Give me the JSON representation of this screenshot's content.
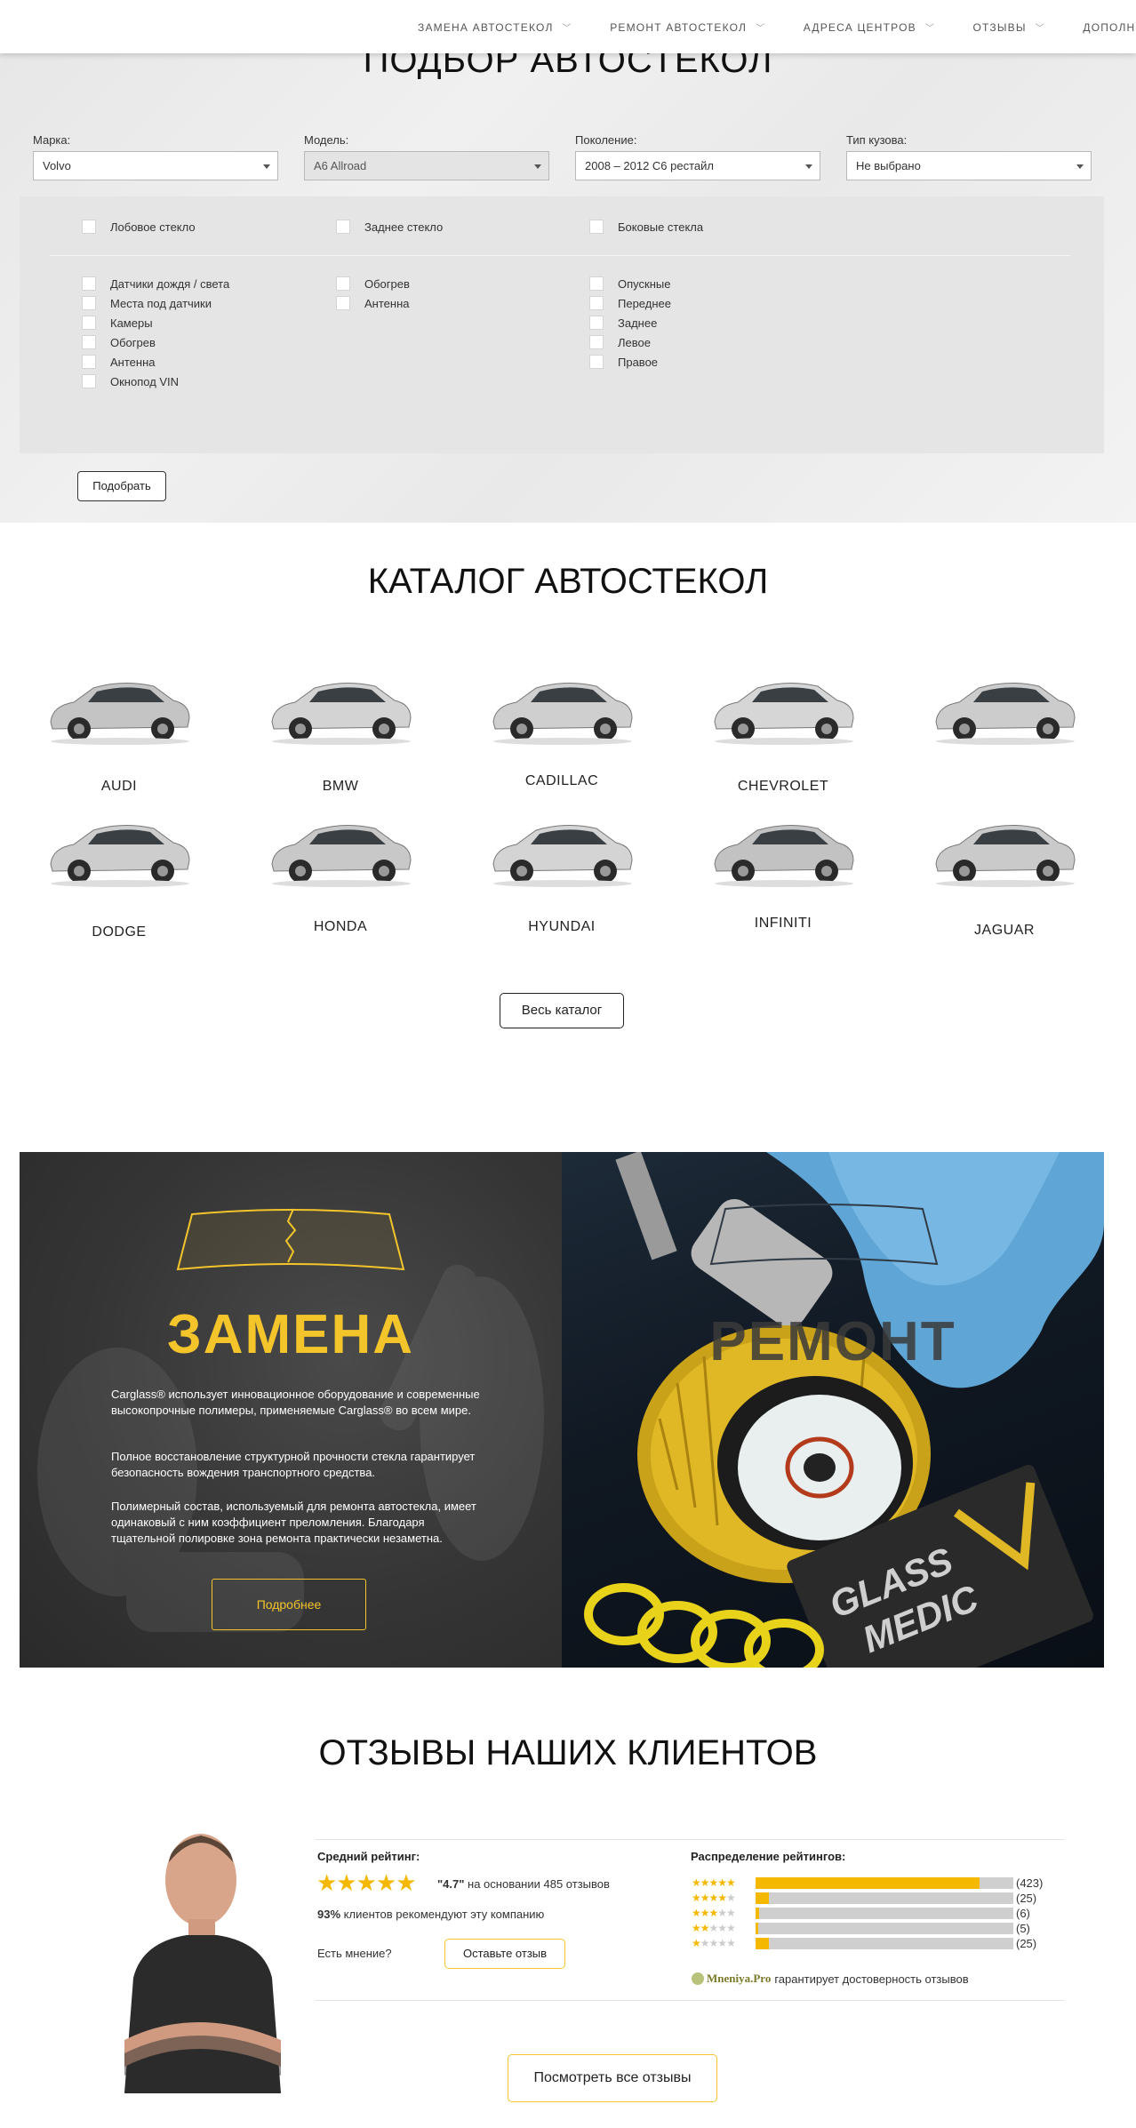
{
  "nav": {
    "items": [
      {
        "label": "ЗАМЕНА АВТОСТЕКОЛ"
      },
      {
        "label": "РЕМОНТ АВТОСТЕКОЛ"
      },
      {
        "label": "АДРЕСА ЦЕНТРОВ"
      },
      {
        "label": "ОТЗЫВЫ"
      },
      {
        "label": "ДОПОЛНИТЕЛЬНЫЕ УСЛУГИ"
      }
    ]
  },
  "selector": {
    "title": "ПОДБОР АВТОСТЕКОЛ",
    "fields": [
      {
        "label": "Марка:",
        "value": "Volvo"
      },
      {
        "label": "Модель:",
        "value": "A6 Allroad"
      },
      {
        "label": "Поколение:",
        "value": "2008 – 2012 C6 рестайл"
      },
      {
        "label": "Тип кузова:",
        "value": "Не выбрано"
      }
    ],
    "glass_types": [
      "Лобовое стекло",
      "Заднее стекло",
      "Боковые стекла"
    ],
    "options_col1": [
      "Датчики дождя / света",
      "Места под датчики",
      "Камеры",
      "Обогрев",
      "Антенна",
      "Окнопод VIN"
    ],
    "options_col2": [
      "Обогрев",
      "Антенна"
    ],
    "options_col3": [
      "Опускные",
      "Переднее",
      "Заднее",
      "Левое",
      "Правое"
    ],
    "submit_label": "Подобрать"
  },
  "catalog": {
    "title": "КАТАЛОГ АВТОСТЕКОЛ",
    "brands": [
      "AUDI",
      "BMW",
      "CADILLAC",
      "CHEVROLET",
      "",
      "DODGE",
      "HONDA",
      "HYUNDAI",
      "INFINITI",
      "JAGUAR"
    ],
    "all_label": "Весь каталог"
  },
  "services": {
    "replace_title": "ЗАМЕНА",
    "replace_p1": "Carglass® использует инновационное оборудование и современные высокопрочные полимеры, применяемые Carglass® во всем мире.",
    "replace_p2": "Полное восстановление структурной прочности стекла гарантирует безопасность вождения транспортного средства.",
    "replace_p3": "Полимерный состав, используемый для ремонта автостекла, имеет одинаковый с ним коэффициент преломления. Благодаря тщательной полировке зона ремонта практически незаметна.",
    "more_label": "Подробнее",
    "repair_title": "РЕМОНТ",
    "accent_color": "#f3c52b"
  },
  "reviews": {
    "title": "ОТЗЫВЫ НАШИХ КЛИЕНТОВ",
    "avg_label": "Средний рейтинг:",
    "avg_value": "\"4.7\"",
    "avg_basis": "на основании 485 отзывов",
    "recommend_pct": "93%",
    "recommend_text": "клиентов рекомендуют эту компанию",
    "opinion_label": "Есть мнение?",
    "feedback_label": "Оставьте отзыв",
    "dist_label": "Распределение рейтингов:",
    "distribution": [
      {
        "stars": 5,
        "count": "(423)",
        "fraction": 0.87
      },
      {
        "stars": 4,
        "count": "(25)",
        "fraction": 0.05
      },
      {
        "stars": 3,
        "count": "(6)",
        "fraction": 0.015
      },
      {
        "stars": 2,
        "count": "(5)",
        "fraction": 0.012
      },
      {
        "stars": 1,
        "count": "(25)",
        "fraction": 0.05
      }
    ],
    "provider": "Mneniya.Pro",
    "provider_text": "гарантирует достоверность отзывов",
    "all_label": "Посмотреть все отзывы"
  }
}
